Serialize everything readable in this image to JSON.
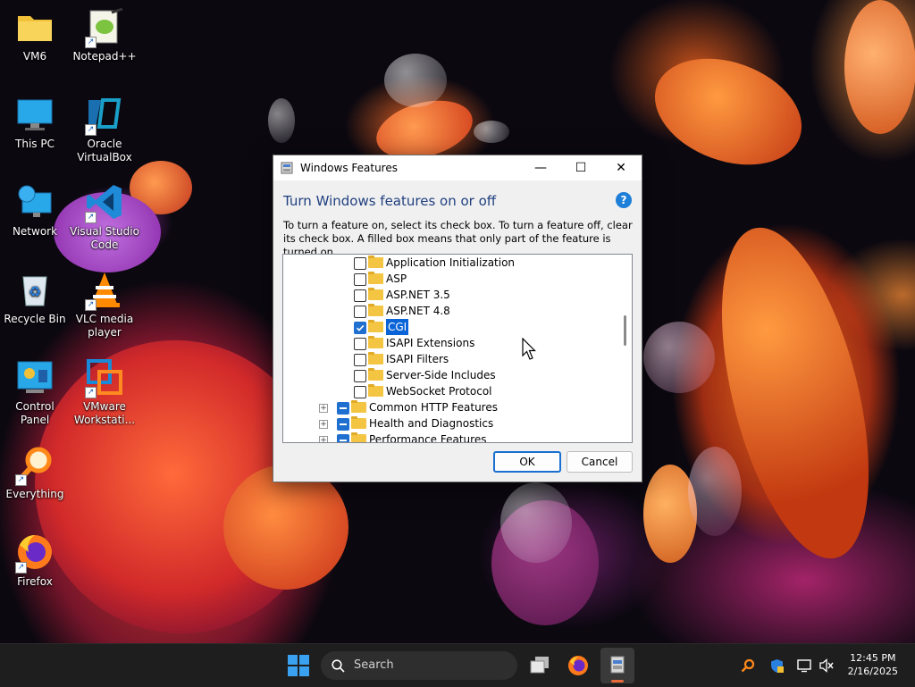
{
  "desktop": {
    "icons": [
      {
        "label_line1": "VM6",
        "label_line2": "",
        "icon": "folder-icon"
      },
      {
        "label_line1": "Notepad++",
        "label_line2": "",
        "icon": "notepadpp-icon"
      },
      {
        "label_line1": "This PC",
        "label_line2": "",
        "icon": "monitor-icon"
      },
      {
        "label_line1": "Oracle",
        "label_line2": "VirtualBox",
        "icon": "virtualbox-icon"
      },
      {
        "label_line1": "Network",
        "label_line2": "",
        "icon": "network-icon"
      },
      {
        "label_line1": "Visual Studio",
        "label_line2": "Code",
        "icon": "vscode-icon"
      },
      {
        "label_line1": "Recycle Bin",
        "label_line2": "",
        "icon": "recycle-bin-icon"
      },
      {
        "label_line1": "VLC media",
        "label_line2": "player",
        "icon": "vlc-icon"
      },
      {
        "label_line1": "Control Panel",
        "label_line2": "",
        "icon": "control-panel-icon"
      },
      {
        "label_line1": "VMware",
        "label_line2": "Workstati...",
        "icon": "vmware-icon"
      },
      {
        "label_line1": "Everything",
        "label_line2": "",
        "icon": "everything-search-icon"
      },
      {
        "label_line1": "Firefox",
        "label_line2": "",
        "icon": "firefox-icon"
      }
    ]
  },
  "dialog": {
    "title": "Windows Features",
    "heading": "Turn Windows features on or off",
    "help_symbol": "?",
    "description": "To turn a feature on, select its check box. To turn a feature off, clear its check box. A filled box means that only part of the feature is turned on.",
    "window_controls": {
      "minimize": "—",
      "maximize": "☐",
      "close": "✕"
    },
    "features": [
      {
        "label": "Application Initialization",
        "state": "unchecked",
        "level": 3
      },
      {
        "label": "ASP",
        "state": "unchecked",
        "level": 3
      },
      {
        "label": "ASP.NET 3.5",
        "state": "unchecked",
        "level": 3
      },
      {
        "label": "ASP.NET 4.8",
        "state": "unchecked",
        "level": 3
      },
      {
        "label": "CGI",
        "state": "checked",
        "level": 3,
        "selected": true
      },
      {
        "label": "ISAPI Extensions",
        "state": "unchecked",
        "level": 3
      },
      {
        "label": "ISAPI Filters",
        "state": "unchecked",
        "level": 3
      },
      {
        "label": "Server-Side Includes",
        "state": "unchecked",
        "level": 3
      },
      {
        "label": "WebSocket Protocol",
        "state": "unchecked",
        "level": 3
      },
      {
        "label": "Common HTTP Features",
        "state": "partial",
        "level": 2,
        "expander": "+"
      },
      {
        "label": "Health and Diagnostics",
        "state": "partial",
        "level": 2,
        "expander": "+"
      },
      {
        "label": "Performance Features",
        "state": "partial",
        "level": 2,
        "expander": "+"
      }
    ],
    "ok_label": "OK",
    "cancel_label": "Cancel"
  },
  "taskbar": {
    "search_placeholder": "Search",
    "clock_time": "12:45 PM",
    "clock_date": "2/16/2025",
    "pinned": [
      "start-icon",
      "search-icon",
      "task-view-icon",
      "firefox-icon",
      "windows-features-icon"
    ],
    "tray": [
      "everything-tray-icon",
      "security-icon",
      "network-icon",
      "volume-muted-icon"
    ]
  },
  "colors": {
    "accent": "#1e6fd0",
    "heading": "#1f3f7f",
    "taskbar": "#1e1e1e",
    "selection": "#0a64d8"
  }
}
